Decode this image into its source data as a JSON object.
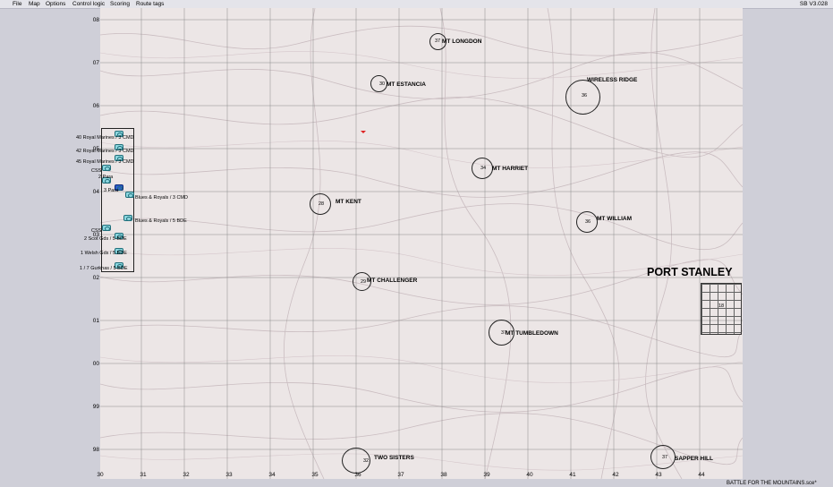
{
  "menu": {
    "file": "File",
    "map": "Map",
    "options": "Options",
    "control_logic": "Control logic",
    "scoring": "Scoring",
    "route_tags": "Route tags"
  },
  "version": "SB V3.028",
  "map": {
    "y_ticks": [
      "08",
      "07",
      "06",
      "05",
      "04",
      "03",
      "02",
      "01",
      "00",
      "99",
      "98"
    ],
    "x_ticks": [
      "30",
      "31",
      "32",
      "33",
      "34",
      "35",
      "36",
      "37",
      "38",
      "39",
      "40",
      "41",
      "42",
      "43",
      "44"
    ]
  },
  "objectives": {
    "mt_longdon": {
      "name": "MT LONGDON",
      "value": "37"
    },
    "mt_estancia": {
      "name": "MT ESTANCIA",
      "value": "30"
    },
    "wireless_ridge": {
      "name": "WIRELESS RIDGE",
      "value": "36"
    },
    "mt_harriet": {
      "name": "MT HARRIET",
      "value": "34"
    },
    "mt_kent": {
      "name": "MT KENT",
      "value": "28"
    },
    "mt_william": {
      "name": "MT WILLIAM",
      "value": "36"
    },
    "mt_challenger": {
      "name": "MT CHALLENGER",
      "value": "29"
    },
    "mt_tumbledown": {
      "name": "MT TUMBLEDOWN",
      "value": "37"
    },
    "two_sisters": {
      "name": "TWO SISTERS",
      "value": "32"
    },
    "sapper_hill": {
      "name": "SAPPER HILL",
      "value": "37"
    }
  },
  "town": {
    "name": "PORT STANLEY",
    "value": "18"
  },
  "units": [
    "40 Royal Marines / 3 CMD",
    "42 Royal Marines / 3 CMD",
    "45 Royal Marines / 3 CMD",
    "CSS",
    "2 Para",
    "3 Para",
    "Blues & Royals / 3 CMD",
    "Blues & Royals / 5 BDE",
    "CSS",
    "2 Scot Gds / 5 BDE",
    "1 Welsh Gds / 5 BDE",
    "1 / 7 Gurkhas / 5 BDE"
  ],
  "status": {
    "filename": "BATTLE FOR THE MOUNTAINS.sce*"
  }
}
